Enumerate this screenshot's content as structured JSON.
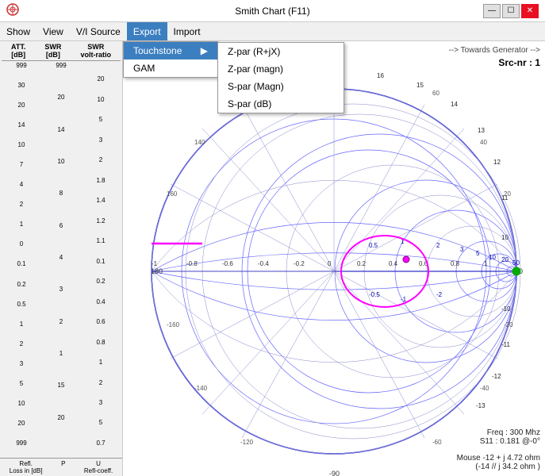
{
  "window": {
    "title": "Smith Chart (F11)",
    "icon": "chart-icon"
  },
  "titlebar": {
    "minimize": "—",
    "maximize": "☐",
    "close": "✕"
  },
  "menubar": {
    "items": [
      {
        "label": "Show",
        "active": false
      },
      {
        "label": "View",
        "active": false
      },
      {
        "label": "V/I Source",
        "active": false
      },
      {
        "label": "Export",
        "active": true
      },
      {
        "label": "Import",
        "active": false
      }
    ]
  },
  "export_menu": {
    "items": [
      {
        "label": "Touchstone",
        "has_submenu": true
      },
      {
        "label": "GAM",
        "has_submenu": false
      }
    ],
    "submenu_items": [
      {
        "label": "Z-par (R+jX)"
      },
      {
        "label": "Z-par (magn)"
      },
      {
        "label": "S-par (Magn)"
      },
      {
        "label": "S-par (dB)"
      }
    ]
  },
  "left_panel": {
    "headers": [
      "ATT.\n[dB]",
      "SWR\n[dB]",
      "SWR\nvolt-ratio"
    ],
    "scales": {
      "att": [
        "999",
        "30",
        "20",
        "14",
        "10",
        "7",
        "4",
        "1",
        "0",
        "0.1",
        "0.2",
        "0.5",
        "1",
        "2",
        "3",
        "5",
        "10",
        "20",
        "999"
      ],
      "swr_db": [
        "999",
        "20",
        "14",
        "10",
        "8",
        "6",
        "4",
        "2",
        "15",
        "20",
        ""
      ],
      "swr_vr": [
        "",
        "20",
        "10",
        "5",
        "3",
        "2",
        "1.8",
        "1.4",
        "1.2",
        "1.1",
        "0.1",
        "0.2",
        "0.4",
        "0.6",
        "0.8",
        "1",
        "2",
        "3",
        "5",
        "0.7"
      ]
    },
    "bottom": {
      "refl_loss": "Refl. Loss in [dB]",
      "p_label": "P",
      "refl_coeff": "Refl-coeff."
    }
  },
  "chart": {
    "generator_arrow": "--> Towards Generator -->",
    "src_label": "Src-nr : 1",
    "freq_label": "Freq : 300 Mhz",
    "s11_label": "S11 : 0.181 @-0°",
    "mouse_label": "Mouse -12 + j 4.72 ohm",
    "mouse_label2": "(-14 // j 34.2 ohm )"
  },
  "colors": {
    "accent_blue": "#0000cc",
    "accent_magenta": "#ff00ff",
    "accent_green": "#00aa00",
    "background": "#ffffff",
    "grid": "#8888ff"
  }
}
